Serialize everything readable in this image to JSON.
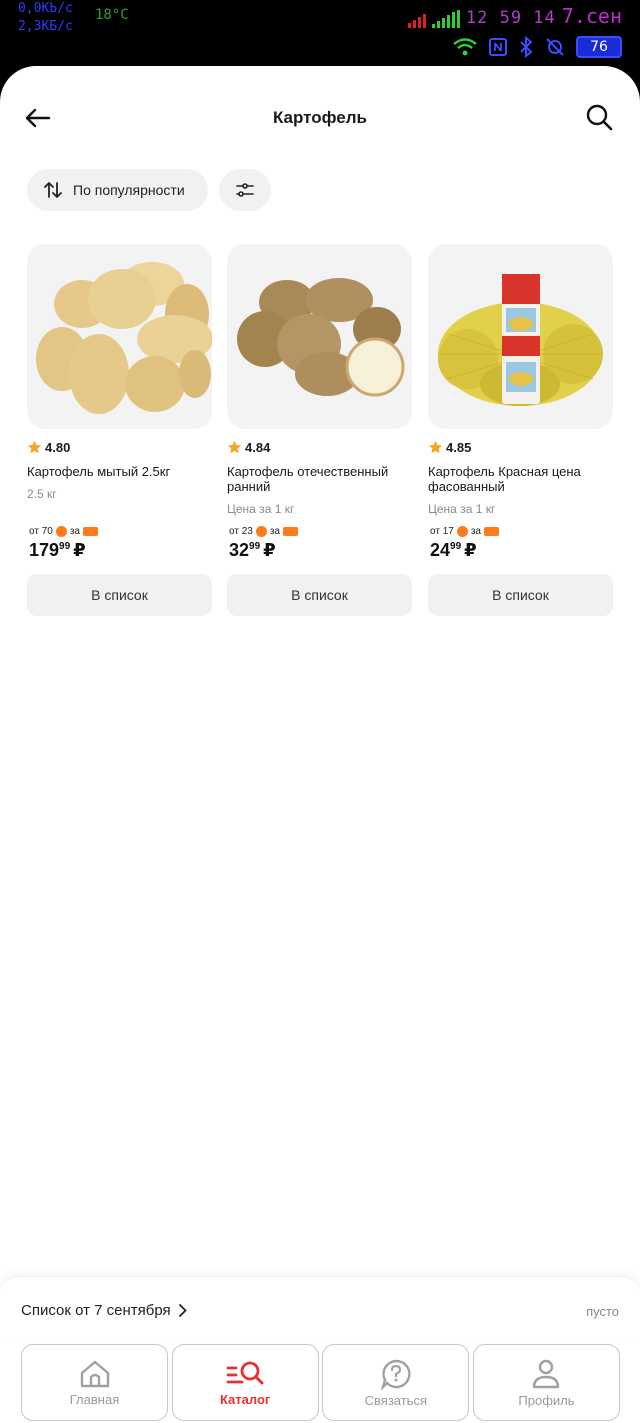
{
  "status_bar": {
    "net_down": "0,0КЬ/с",
    "net_up": "2,3КБ/с",
    "temperature": "18°C",
    "time": "12 59 14",
    "date": "7.сен",
    "battery": "76"
  },
  "header": {
    "title": "Картофель"
  },
  "sort": {
    "label": "По популярности"
  },
  "products": [
    {
      "rating": "4.80",
      "name": "Картофель мытый 2.5кг",
      "unit": "2.5 кг",
      "promo_from": "от 70",
      "promo_for": "за",
      "price_main": "179",
      "price_cents": "99",
      "currency": "₽",
      "button": "В список"
    },
    {
      "rating": "4.84",
      "name": "Картофель отечественный ранний",
      "unit": "Цена за 1 кг",
      "promo_from": "от 23",
      "promo_for": "за",
      "price_main": "32",
      "price_cents": "99",
      "currency": "₽",
      "button": "В список"
    },
    {
      "rating": "4.85",
      "name": "Картофель Красная цена фасованный",
      "unit": "Цена за 1 кг",
      "promo_from": "от 17",
      "promo_for": "за",
      "price_main": "24",
      "price_cents": "99",
      "currency": "₽",
      "button": "В список"
    }
  ],
  "list_bar": {
    "title": "Список от 7 сентября",
    "status": "пусто"
  },
  "nav": [
    {
      "label": "Главная",
      "icon": "home-icon",
      "active": false
    },
    {
      "label": "Каталог",
      "icon": "catalog-search-icon",
      "active": true
    },
    {
      "label": "Связаться",
      "icon": "help-chat-icon",
      "active": false
    },
    {
      "label": "Профиль",
      "icon": "profile-icon",
      "active": false
    }
  ],
  "colors": {
    "accent": "#e53131",
    "promo": "#ff7a1a",
    "star": "#f5a623"
  }
}
